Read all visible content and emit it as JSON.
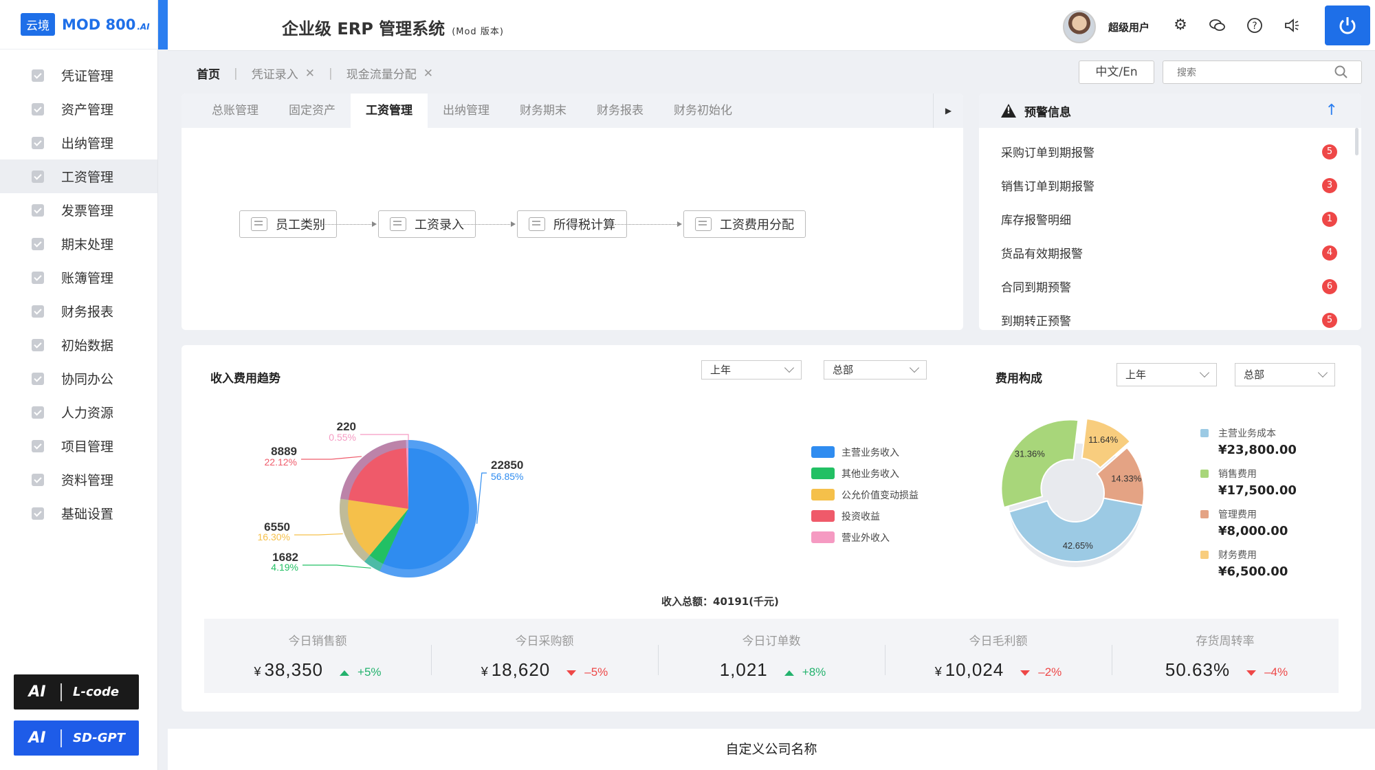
{
  "logo": {
    "badge": "云境",
    "name": "MOD 800",
    "ai": ".AI"
  },
  "sidebar": {
    "items": [
      {
        "label": "凭证管理",
        "active": false
      },
      {
        "label": "资产管理",
        "active": false
      },
      {
        "label": "出纳管理",
        "active": false
      },
      {
        "label": "工资管理",
        "active": true
      },
      {
        "label": "发票管理",
        "active": false
      },
      {
        "label": "期末处理",
        "active": false
      },
      {
        "label": "账簿管理",
        "active": false
      },
      {
        "label": "财务报表",
        "active": false
      },
      {
        "label": "初始数据",
        "active": false
      },
      {
        "label": "协同办公",
        "active": false
      },
      {
        "label": "人力资源",
        "active": false
      },
      {
        "label": "项目管理",
        "active": false
      },
      {
        "label": "资料管理",
        "active": false
      },
      {
        "label": "基础设置",
        "active": false
      }
    ],
    "ai_buttons": [
      {
        "ai": "AI",
        "label": "L-code"
      },
      {
        "ai": "AI",
        "label": "SD-GPT"
      }
    ]
  },
  "header": {
    "title": "企业级 ERP 管理系统",
    "subtitle": "(Mod 版本)",
    "username": "超级用户"
  },
  "breadcrumb": {
    "home": "首页",
    "tabs": [
      "凭证录入",
      "现金流量分配"
    ]
  },
  "toolbar": {
    "lang": "中文/En",
    "search_placeholder": "搜索"
  },
  "module_tabs": {
    "items": [
      "总账管理",
      "固定资产",
      "工资管理",
      "出纳管理",
      "财务期末",
      "财务报表",
      "财务初始化"
    ],
    "active_index": 2
  },
  "flow": {
    "steps": [
      "员工类别",
      "工资录入",
      "所得税计算",
      "工资费用分配"
    ]
  },
  "warnings": {
    "title": "预警信息",
    "items": [
      {
        "label": "采购订单到期报警",
        "count": "5"
      },
      {
        "label": "销售订单到期报警",
        "count": "3"
      },
      {
        "label": "库存报警明细",
        "count": "1"
      },
      {
        "label": "货品有效期报警",
        "count": "4"
      },
      {
        "label": "合同到期预警",
        "count": "6"
      },
      {
        "label": "到期转正预警",
        "count": "5"
      }
    ]
  },
  "income_section": {
    "title": "收入费用趋势",
    "select_period": "上年",
    "select_scope": "总部",
    "total_label": "收入总额：",
    "total_value": "40191(千元)"
  },
  "cost_section": {
    "title": "费用构成",
    "select_period": "上年",
    "select_scope": "总部"
  },
  "chart_data": [
    {
      "type": "pie",
      "title": "收入费用趋势",
      "categories": [
        "主营业务收入",
        "其他业务收入",
        "公允价值变动损益",
        "投资收益",
        "营业外收入"
      ],
      "values": [
        22850,
        1682,
        6550,
        8889,
        220
      ],
      "percents": [
        "56.85%",
        "4.19%",
        "16.30%",
        "22.12%",
        "0.55%"
      ],
      "colors": [
        "#2f8cf0",
        "#22c064",
        "#f5c04a",
        "#ef5a6a",
        "#f59ac2"
      ],
      "legend": "right",
      "total": "40191(千元)"
    },
    {
      "type": "pie",
      "title": "费用构成",
      "categories": [
        "主营业务成本",
        "销售费用",
        "管理费用",
        "财务费用"
      ],
      "values": [
        23800,
        17500,
        8000,
        6500
      ],
      "percents": [
        "42.65%",
        "31.36%",
        "14.33%",
        "11.64%"
      ],
      "value_labels": [
        "¥23,800.00",
        "¥17,500.00",
        "¥8,000.00",
        "¥6,500.00"
      ],
      "colors": [
        "#9ccae4",
        "#a8d67a",
        "#e4a384",
        "#f8cd7e"
      ],
      "legend": "right"
    }
  ],
  "stats": [
    {
      "label": "今日销售额",
      "currency": "¥",
      "value": "38,350",
      "change": "+5%",
      "direction": "up"
    },
    {
      "label": "今日采购额",
      "currency": "¥",
      "value": "18,620",
      "change": "–5%",
      "direction": "down"
    },
    {
      "label": "今日订单数",
      "currency": "",
      "value": "1,021",
      "change": "+8%",
      "direction": "up"
    },
    {
      "label": "今日毛利额",
      "currency": "¥",
      "value": "10,024",
      "change": "–2%",
      "direction": "down"
    },
    {
      "label": "存货周转率",
      "currency": "",
      "value": "50.63%",
      "change": "–4%",
      "direction": "down"
    }
  ],
  "footer": {
    "company": "自定义公司名称"
  }
}
